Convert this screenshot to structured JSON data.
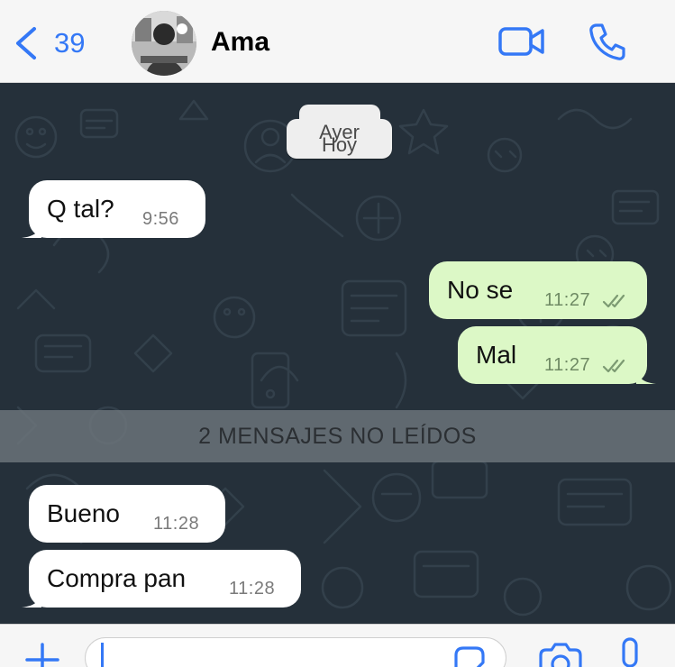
{
  "header": {
    "back_count": "39",
    "contact_name": "Ama",
    "avatar_icon": "contact-avatar",
    "back_icon": "chevron-left-icon",
    "video_icon": "video-camera-icon",
    "call_icon": "phone-icon"
  },
  "chat": {
    "date_chip_back": "Ayer",
    "date_chip_front": "Hoy",
    "messages": [
      {
        "direction": "incoming",
        "text": "Q tal?",
        "time": "9:56"
      },
      {
        "direction": "outgoing",
        "text": "No se",
        "time": "11:27",
        "status": "read"
      },
      {
        "direction": "outgoing",
        "text": "Mal",
        "time": "11:27",
        "status": "read"
      },
      {
        "direction": "incoming",
        "text": "Bueno",
        "time": "11:28"
      },
      {
        "direction": "incoming",
        "text": "Compra pan",
        "time": "11:28"
      }
    ],
    "unread_banner": "2 MENSAJES NO LEÍDOS"
  },
  "composer": {
    "input_value": "",
    "icons": [
      "plus-icon",
      "sticker-icon",
      "camera-icon",
      "microphone-icon"
    ]
  },
  "colors": {
    "accent": "#3478f6",
    "chat_background": "#25303a",
    "incoming_bubble": "#ffffff",
    "outgoing_bubble": "#dcf8c6",
    "unread_banner": "#6e767c"
  }
}
